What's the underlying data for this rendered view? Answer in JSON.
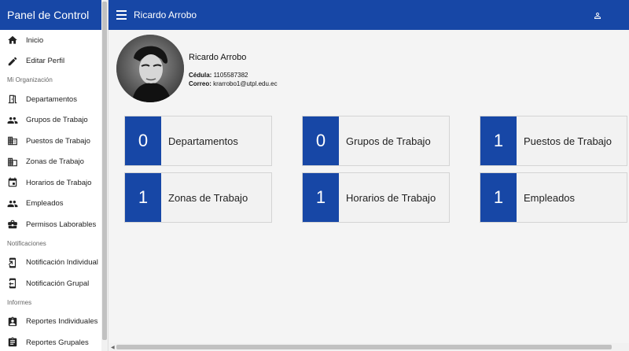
{
  "sidebar": {
    "title": "Panel de Control",
    "items": [
      {
        "type": "item",
        "label": "Inicio",
        "icon": "home-icon"
      },
      {
        "type": "item",
        "label": "Editar Perfil",
        "icon": "pencil-icon"
      },
      {
        "type": "section",
        "label": "Mi Organización"
      },
      {
        "type": "item",
        "label": "Departamentos",
        "icon": "door-icon"
      },
      {
        "type": "item",
        "label": "Grupos de Trabajo",
        "icon": "people-icon"
      },
      {
        "type": "item",
        "label": "Puestos de Trabajo",
        "icon": "business-icon"
      },
      {
        "type": "item",
        "label": "Zonas de Trabajo",
        "icon": "domain-icon"
      },
      {
        "type": "item",
        "label": "Horarios de Trabajo",
        "icon": "calendar-icon"
      },
      {
        "type": "item",
        "label": "Empleados",
        "icon": "people-icon"
      },
      {
        "type": "item",
        "label": "Permisos Laborables",
        "icon": "briefcase-icon"
      },
      {
        "type": "section",
        "label": "Notificaciones"
      },
      {
        "type": "item",
        "label": "Notificación Individual",
        "icon": "phone-forward-icon"
      },
      {
        "type": "item",
        "label": "Notificación Grupal",
        "icon": "phone-sync-icon"
      },
      {
        "type": "section",
        "label": "Informes"
      },
      {
        "type": "item",
        "label": "Reportes Individuales",
        "icon": "assignment-ind-icon"
      },
      {
        "type": "item",
        "label": "Reportes Grupales",
        "icon": "assignment-icon"
      }
    ]
  },
  "topbar": {
    "title": "Ricardo Arrobo"
  },
  "profile": {
    "name": "Ricardo Arrobo",
    "cedula_label": "Cédula:",
    "cedula_value": "1105587382",
    "correo_label": "Correo:",
    "correo_value": "krarrobo1@utpl.edu.ec"
  },
  "cards": [
    {
      "value": "0",
      "label": "Departamentos"
    },
    {
      "value": "0",
      "label": "Grupos de Trabajo"
    },
    {
      "value": "1",
      "label": "Puestos de Trabajo"
    },
    {
      "value": "1",
      "label": "Zonas de Trabajo"
    },
    {
      "value": "1",
      "label": "Horarios de Trabajo"
    },
    {
      "value": "1",
      "label": "Empleados"
    }
  ],
  "colors": {
    "primary": "#1747a6",
    "background": "#f4f4f4"
  }
}
